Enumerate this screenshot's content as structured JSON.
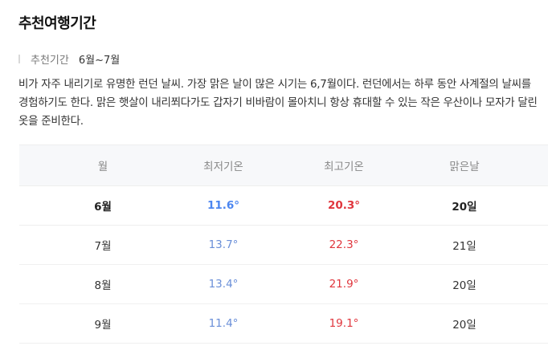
{
  "title": "추천여행기간",
  "period": {
    "label": "추천기간",
    "value": "6월~7월"
  },
  "description": "비가 자주 내리기로 유명한 런던 날씨. 가장 맑은 날이 많은 시기는 6,7월이다. 런던에서는 하루 동안 사계절의 날씨를 경험하기도 한다. 맑은 햇살이 내리쬐다가도 갑자기 비바람이 몰아치니 항상 휴대할 수 있는 작은 우산이나 모자가 달린 옷을 준비한다.",
  "table": {
    "headers": [
      "월",
      "최저기온",
      "최고기온",
      "맑은날"
    ],
    "rows": [
      {
        "month": "6월",
        "low": "11.6°",
        "high": "20.3°",
        "clear": "20일"
      },
      {
        "month": "7월",
        "low": "13.7°",
        "high": "22.3°",
        "clear": "21일"
      },
      {
        "month": "8월",
        "low": "13.4°",
        "high": "21.9°",
        "clear": "20일"
      },
      {
        "month": "9월",
        "low": "11.4°",
        "high": "19.1°",
        "clear": "20일"
      }
    ]
  },
  "colors": {
    "low_temp": "#6a8fd8",
    "high_temp": "#e0363d",
    "highlight_low": "#4c86f0"
  }
}
